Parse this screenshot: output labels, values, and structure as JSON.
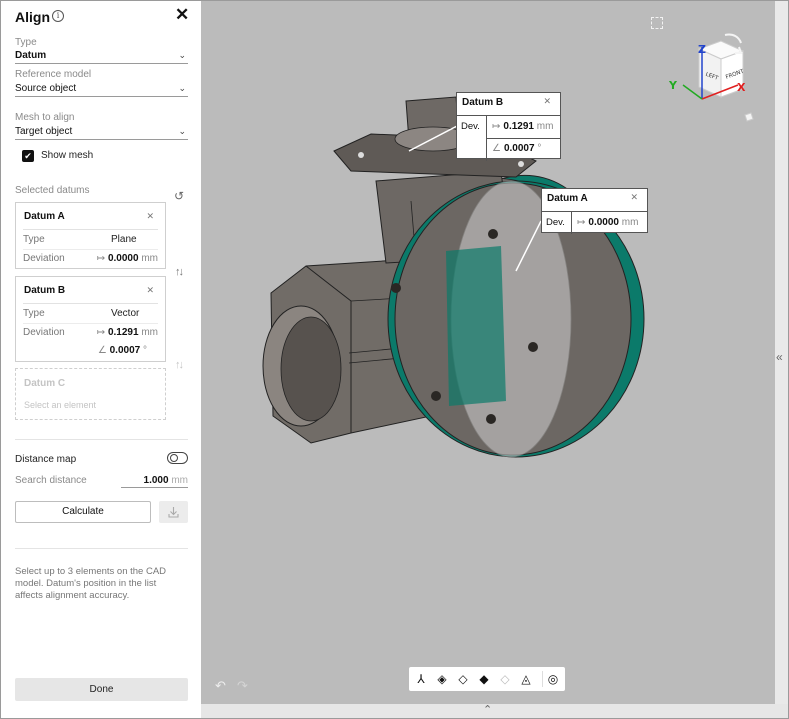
{
  "panel": {
    "title": "Align",
    "type_label": "Type",
    "type_value": "Datum",
    "reference_label": "Reference model",
    "reference_value": "Source object",
    "mesh_label": "Mesh to align",
    "mesh_value": "Target object",
    "show_mesh_label": "Show mesh",
    "show_mesh_checked": true,
    "selected_datums_label": "Selected datums",
    "datums": [
      {
        "title": "Datum A",
        "type_label": "Type",
        "type_value": "Plane",
        "deviation_label": "Deviation",
        "deviation_value": "0.0000",
        "deviation_unit": "mm"
      },
      {
        "title": "Datum B",
        "type_label": "Type",
        "type_value": "Vector",
        "deviation_label": "Deviation",
        "deviation_value": "0.1291",
        "deviation_unit": "mm",
        "angle_value": "0.0007",
        "angle_unit": "°"
      }
    ],
    "datum_c": {
      "title": "Datum C",
      "placeholder": "Select an element"
    },
    "distance_map_label": "Distance map",
    "distance_map_on": false,
    "search_distance_label": "Search distance",
    "search_distance_value": "1.000",
    "search_distance_unit": "mm",
    "calculate_label": "Calculate",
    "help_text": "Select up to 3 elements on the CAD model. Datum's position in the list affects alignment accuracy.",
    "done_label": "Done"
  },
  "viewport": {
    "view_cube": {
      "top": "Z",
      "left": "LEFT",
      "front": "FRONT",
      "axis_x": "X",
      "axis_y": "Y",
      "axis_z": "Z"
    },
    "callouts": [
      {
        "title": "Datum B",
        "dev_label": "Dev.",
        "deviation_value": "0.1291",
        "deviation_unit": "mm",
        "angle_value": "0.0007",
        "angle_unit": "°"
      },
      {
        "title": "Datum A",
        "dev_label": "Dev.",
        "deviation_value": "0.0000",
        "deviation_unit": "mm"
      }
    ],
    "toolbar_icons": [
      "axes-icon",
      "view-front-icon",
      "view-side-icon",
      "view-top-icon",
      "view-iso-icon",
      "section-icon",
      "measure-icon"
    ]
  },
  "colors": {
    "mesh_teal": "#0b7a6a",
    "part_gray": "#6f6a66",
    "viewport_bg": "#bbbbbb",
    "axis_x": "#e02020",
    "axis_y": "#22aa22",
    "axis_z": "#2244cc"
  }
}
